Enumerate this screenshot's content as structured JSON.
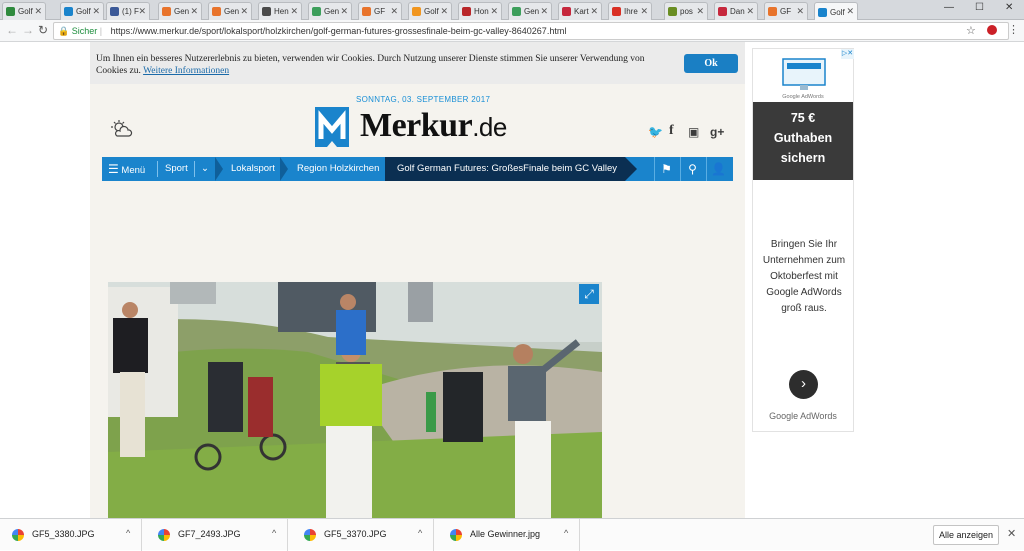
{
  "tabs": [
    {
      "label": "Golf",
      "color": "#2f8a3e"
    },
    {
      "label": "Golf",
      "color": "#1a84cc"
    },
    {
      "label": "(1) F",
      "color": "#3b5998"
    },
    {
      "label": "Gen",
      "color": "#e8742c"
    },
    {
      "label": "Gen",
      "color": "#e8742c"
    },
    {
      "label": "Hen",
      "color": "#4a4a4a"
    },
    {
      "label": "Gen",
      "color": "#3d9f5c"
    },
    {
      "label": "GF",
      "color": "#e8742c"
    },
    {
      "label": "Golf",
      "color": "#f19620"
    },
    {
      "label": "Hon",
      "color": "#b9272a"
    },
    {
      "label": "Gen",
      "color": "#3d9f5c"
    },
    {
      "label": "Kart",
      "color": "#c6283d"
    },
    {
      "label": "Ihre",
      "color": "#d93025"
    },
    {
      "label": "pos",
      "color": "#6a8e23"
    },
    {
      "label": "Dan",
      "color": "#c6283d"
    },
    {
      "label": "GF",
      "color": "#e8742c"
    },
    {
      "label": "Golf",
      "color": "#1a84cc",
      "active": true
    }
  ],
  "address": {
    "secure_label": "Sicher",
    "url": "https://www.merkur.de/sport/lokalsport/holzkirchen/golf-german-futures-grossesfinale-beim-gc-valley-8640267.html"
  },
  "cookie": {
    "text": "Um Ihnen ein besseres Nutzererlebnis zu bieten, verwenden wir Cookies. Durch Nutzung unserer Dienste stimmen Sie unserer Verwendung von Cookies zu.",
    "link": "Weitere Informationen",
    "ok": "Ok"
  },
  "header": {
    "date": "SONNTAG, 03. SEPTEMBER 2017",
    "logo_name": "Merkur",
    "logo_tld": ".de"
  },
  "nav": {
    "menu": "Menü",
    "crumbs": [
      "Sport",
      "Lokalsport",
      "Region Holzkirchen"
    ],
    "current": "Golf German Futures: GroßesFinale beim GC Valley"
  },
  "ad": {
    "top_label": "Google AdWords",
    "promo": [
      "75 €",
      "Guthaben",
      "sichern"
    ],
    "body": "Bringen Sie Ihr Unternehmen zum Oktoberfest mit Google AdWords groß raus.",
    "footer": "Google AdWords"
  },
  "downloads": {
    "files": [
      "GF5_3380.JPG",
      "GF7_2493.JPG",
      "GF5_3370.JPG",
      "Alle Gewinner.jpg"
    ],
    "show_all": "Alle anzeigen"
  }
}
